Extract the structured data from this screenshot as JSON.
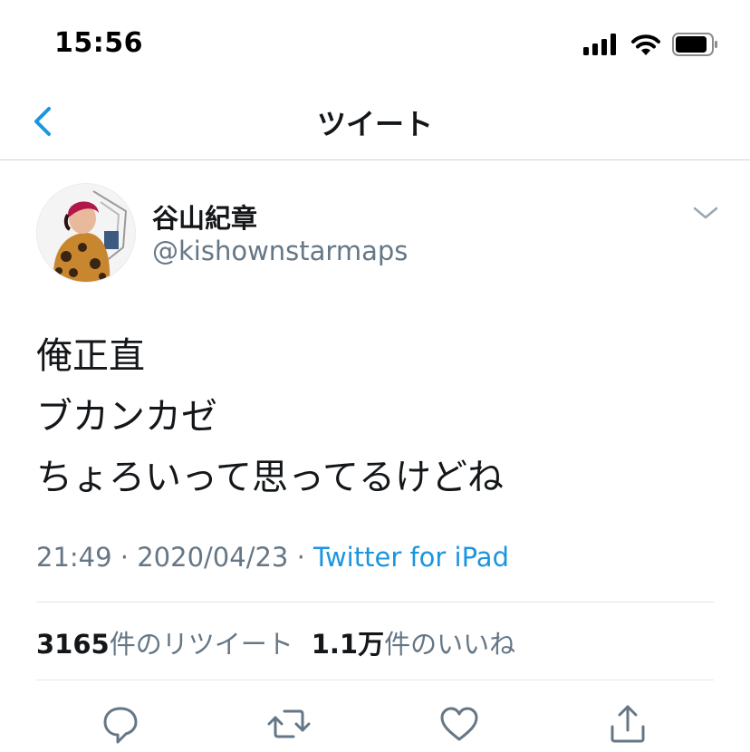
{
  "status_bar": {
    "time": "15:56",
    "icons": [
      "signal-icon",
      "wifi-icon",
      "battery-icon"
    ]
  },
  "nav": {
    "title": "ツイート",
    "back_icon": "chevron-left-icon"
  },
  "tweet": {
    "author": {
      "display_name": "谷山紀章",
      "handle": "@kishownstarmaps"
    },
    "text_lines": [
      "俺正直",
      "ブカンカゼ",
      "ちょろいって思ってるけどね"
    ],
    "time": "21:49",
    "separator": "·",
    "date": "2020/04/23",
    "source": "Twitter for iPad",
    "retweets": {
      "count": "3165",
      "label": "件のリツイート"
    },
    "likes": {
      "count": "1.1万",
      "label": "件のいいね"
    }
  },
  "actions": [
    "reply-icon",
    "retweet-icon",
    "like-icon",
    "share-icon"
  ],
  "colors": {
    "accent": "#1b95e0",
    "secondary_text": "#657786",
    "primary_text": "#14171a",
    "divider": "#e1e8ed"
  }
}
